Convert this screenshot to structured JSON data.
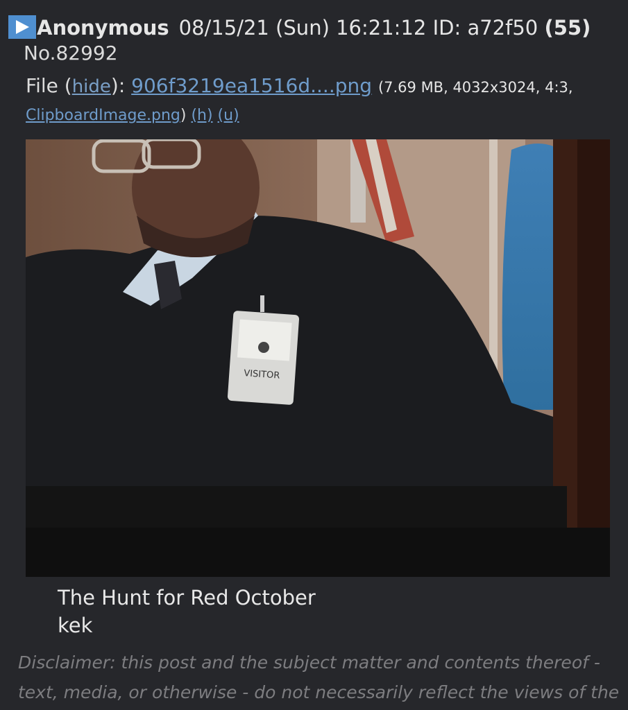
{
  "post": {
    "name": "Anonymous",
    "date": "08/15/21 (Sun) 16:21:12",
    "id_label": "ID:",
    "id": "a72f50",
    "count": "(55)",
    "number": "No.82992"
  },
  "file": {
    "label": "File",
    "hide_label": "hide",
    "filename": "906f3219ea1516d....png",
    "meta": "(7.69 MB, 4032x3024, 4:3,",
    "original_name": "ClipboardImage.png",
    "h_label": "(h)",
    "u_label": "(u)"
  },
  "image": {
    "badge_text": "VISITOR"
  },
  "message": {
    "line1": "The Hunt for Red October",
    "line2": "kek"
  },
  "disclaimer": {
    "line1": "Disclaimer: this post and the subject matter and contents thereof -",
    "line2": "text, media, or otherwise - do not necessarily reflect the views of the"
  },
  "colors": {
    "background": "#26272b",
    "link": "#6f9ccb",
    "play_icon": "#4f8fd0"
  }
}
